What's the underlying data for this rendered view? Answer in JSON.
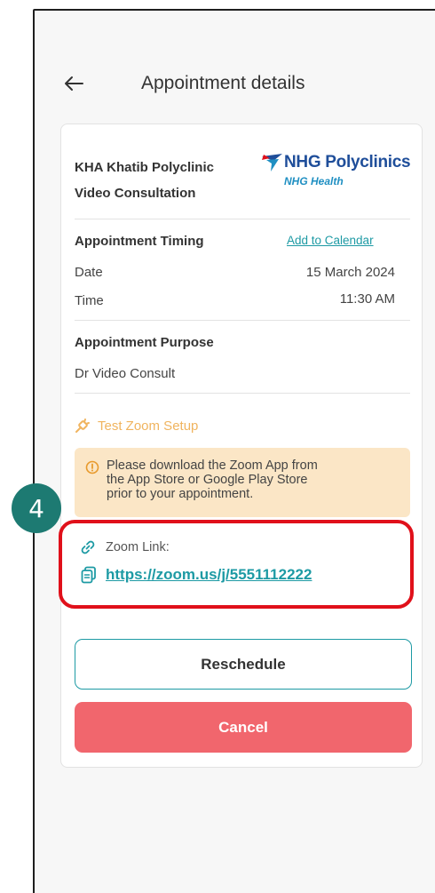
{
  "header": {
    "title": "Appointment details",
    "back_icon": "arrow-left-icon"
  },
  "clinic": {
    "name": "KHA Khatib Polyclinic",
    "type": "Video Consultation"
  },
  "logo": {
    "main": "NHG Polyclinics",
    "sub": "NHG Health"
  },
  "timing": {
    "title": "Appointment Timing",
    "add_to_calendar": "Add to Calendar",
    "date_label": "Date",
    "date_value": "15 March 2024",
    "time_label": "Time",
    "time_value": "11:30 AM"
  },
  "purpose": {
    "title": "Appointment Purpose",
    "value": "Dr Video Consult"
  },
  "test_zoom": {
    "label": "Test Zoom Setup"
  },
  "notice": {
    "line1": "Please download the Zoom App from",
    "line2": "the App Store or Google Play Store",
    "line3": "prior to your appointment."
  },
  "zoom": {
    "label": "Zoom Link:",
    "url": "https://zoom.us/j/5551112222"
  },
  "buttons": {
    "reschedule": "Reschedule",
    "cancel": "Cancel"
  },
  "annotation": {
    "step": "4"
  },
  "colors": {
    "accent": "#1d9aa4",
    "cancel": "#f1666d",
    "notice_bg": "#fbe6c6",
    "highlight": "#e0101a",
    "badge": "#1d7a72"
  }
}
